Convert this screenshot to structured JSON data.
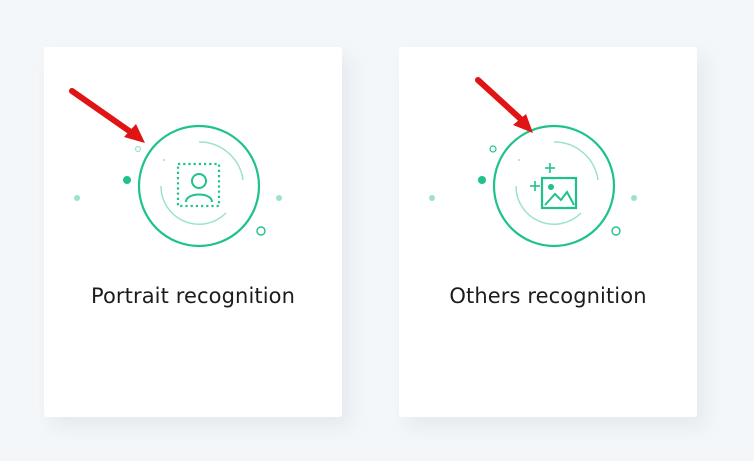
{
  "colors": {
    "accent": "#1fc28d",
    "accent_light": "#9be3c9",
    "arrow": "#e01414",
    "card_bg": "#ffffff",
    "page_bg": "#f4f7f9"
  },
  "cards": [
    {
      "label": "Portrait recognition",
      "icon": "portrait-recognition-icon"
    },
    {
      "label": "Others recognition",
      "icon": "image-recognition-icon"
    }
  ]
}
